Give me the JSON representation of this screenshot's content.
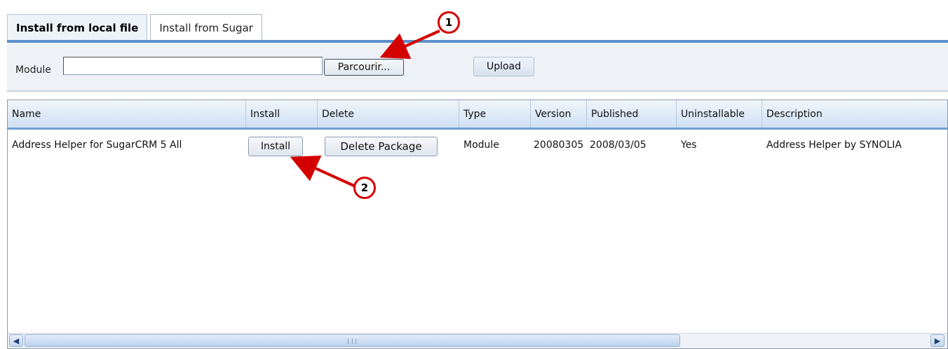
{
  "tabs": [
    {
      "label": "Install from local file",
      "active": true
    },
    {
      "label": "Install from Sugar",
      "active": false
    }
  ],
  "upload": {
    "module_label": "Module",
    "module_value": "",
    "browse_label": "Parcourir...",
    "upload_label": "Upload"
  },
  "table": {
    "headers": [
      "Name",
      "Install",
      "Delete",
      "Type",
      "Version",
      "Published",
      "Uninstallable",
      "Description"
    ],
    "rows": [
      {
        "name": "Address Helper for SugarCRM 5 All",
        "install_label": "Install",
        "delete_label": "Delete Package",
        "type": "Module",
        "version": "20080305",
        "published": "2008/03/05",
        "uninstallable": "Yes",
        "description": "Address Helper by SYNOLIA"
      }
    ]
  },
  "callouts": [
    "1",
    "2"
  ],
  "colors": {
    "accent": "#5b8fcb",
    "callout": "#d40000"
  },
  "icons": {
    "scroll_left": "arrow-left-icon",
    "scroll_right": "arrow-right-icon"
  }
}
